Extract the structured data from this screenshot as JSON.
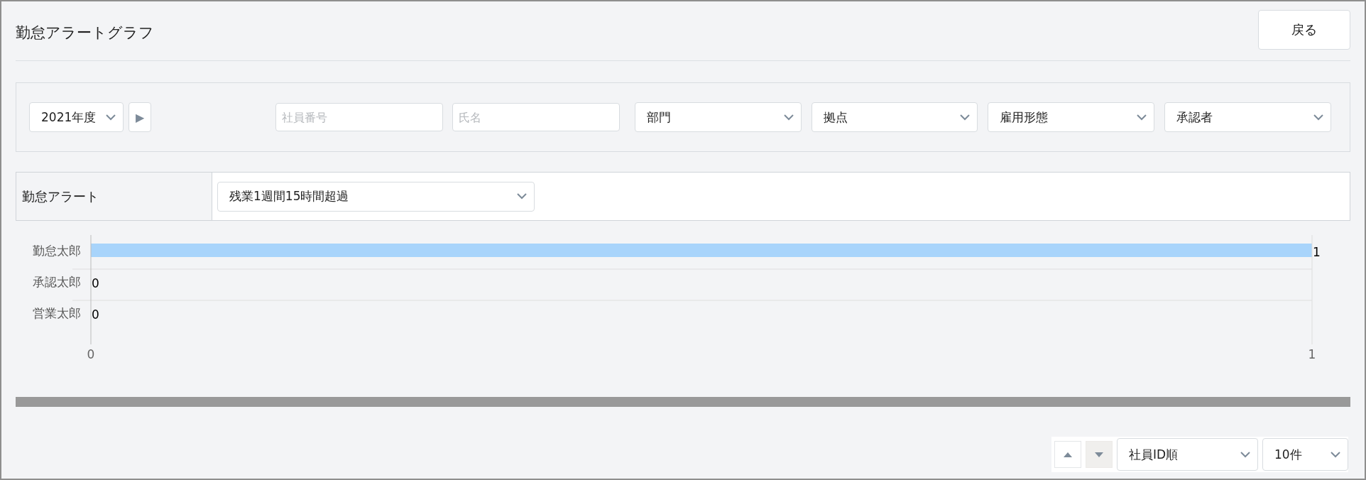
{
  "header": {
    "title": "勤怠アラートグラフ",
    "back_button": "戻る"
  },
  "filters": {
    "year": {
      "value": "2021年度",
      "next_button": "▶"
    },
    "employee_number": {
      "placeholder": "社員番号"
    },
    "name": {
      "placeholder": "氏名"
    },
    "selects": [
      {
        "value": "部門"
      },
      {
        "value": "拠点"
      },
      {
        "value": "雇用形態"
      },
      {
        "value": "承認者"
      }
    ]
  },
  "alert": {
    "label": "勤怠アラート",
    "value": "残業1週間15時間超過"
  },
  "chart_data": {
    "type": "bar",
    "orientation": "horizontal",
    "categories": [
      "勤怠太郎",
      "承認太郎",
      "営業太郎"
    ],
    "series": [
      {
        "color": "#a8d4fb",
        "values": [
          1,
          0,
          0
        ]
      }
    ],
    "xlim": [
      0,
      1
    ],
    "xticks": [
      0,
      1
    ],
    "data_labels": true
  },
  "pager": {
    "sort_buttons": [
      {
        "kind": "up",
        "selected": false
      },
      {
        "kind": "down",
        "selected": true
      }
    ],
    "sort": "社員ID順",
    "count": "10件"
  }
}
